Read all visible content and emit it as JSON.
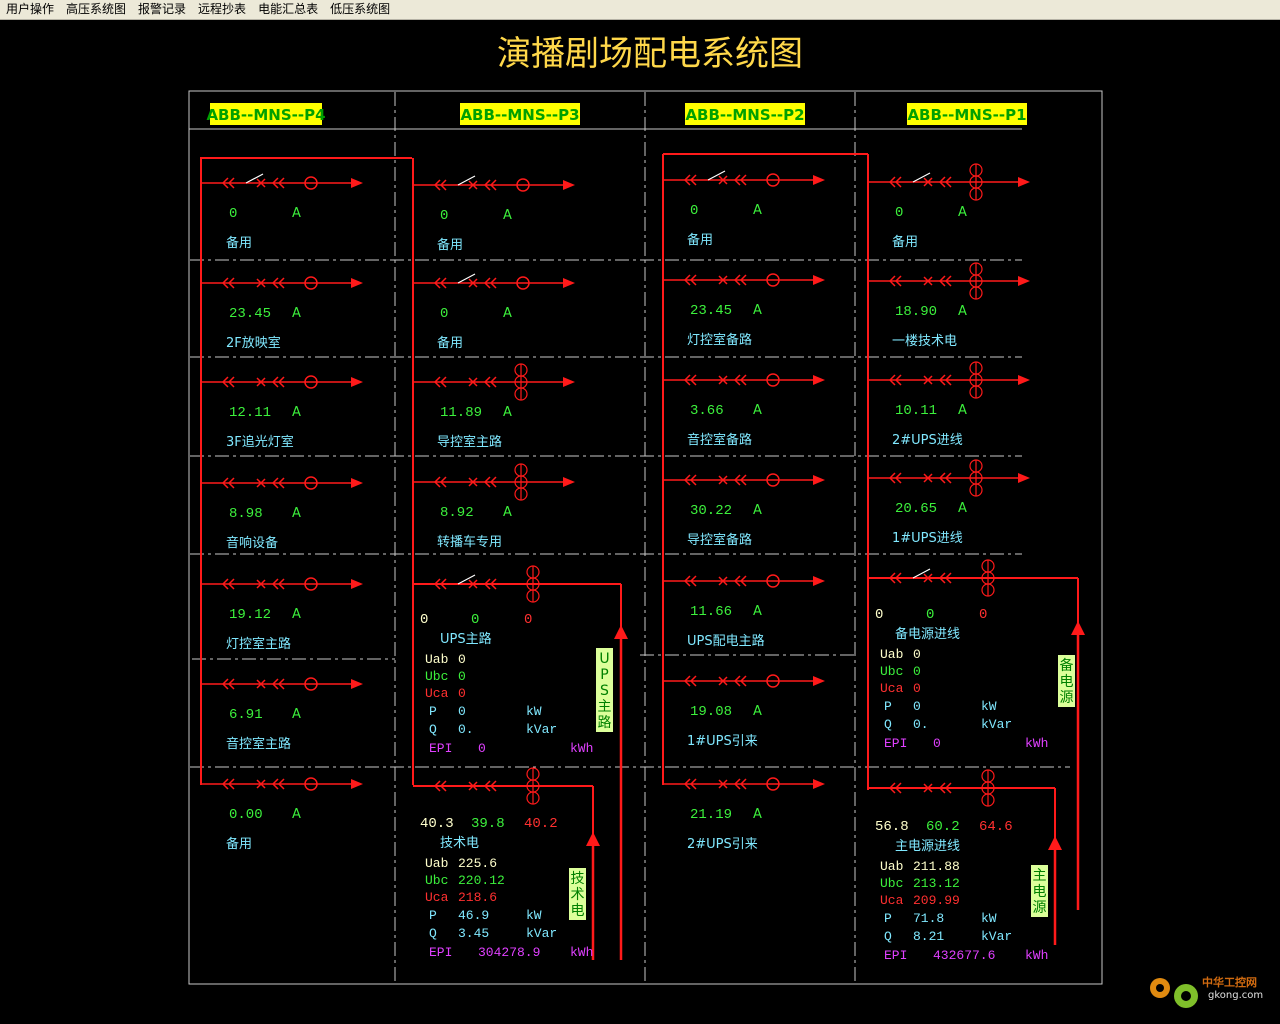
{
  "menu": [
    "用户操作",
    "高压系统图",
    "报警记录",
    "远程抄表",
    "电能汇总表",
    "低压系统图"
  ],
  "title": "演播剧场配电系统图",
  "panels": [
    "ABB--MNS--P4",
    "ABB--MNS--P3",
    "ABB--MNS--P2",
    "ABB--MNS--P1"
  ],
  "unit_a": "A",
  "p4": [
    {
      "value": "0",
      "name": "备用"
    },
    {
      "value": "23.45",
      "name": "2F放映室"
    },
    {
      "value": "12.11",
      "name": "3F追光灯室"
    },
    {
      "value": "8.98",
      "name": "音响设备"
    },
    {
      "value": "19.12",
      "name": "灯控室主路"
    },
    {
      "value": "6.91",
      "name": "音控室主路"
    },
    {
      "value": "0.00",
      "name": "备用"
    }
  ],
  "p3": [
    {
      "value": "0",
      "name": "备用"
    },
    {
      "value": "0",
      "name": "备用"
    },
    {
      "value": "11.89",
      "name": "导控室主路"
    },
    {
      "value": "8.92",
      "name": "转播车专用"
    }
  ],
  "p2": [
    {
      "value": "0",
      "name": "备用"
    },
    {
      "value": "23.45",
      "name": "灯控室备路"
    },
    {
      "value": "3.66",
      "name": "音控室备路"
    },
    {
      "value": "30.22",
      "name": "导控室备路"
    },
    {
      "value": "11.66",
      "name": "UPS配电主路"
    },
    {
      "value": "19.08",
      "name": "1#UPS引来"
    },
    {
      "value": "21.19",
      "name": "2#UPS引来"
    }
  ],
  "p1": [
    {
      "value": "0",
      "name": "备用"
    },
    {
      "value": "18.90",
      "name": "一楼技术电"
    },
    {
      "value": "10.11",
      "name": "2#UPS进线"
    },
    {
      "value": "20.65",
      "name": "1#UPS进线"
    }
  ],
  "labels": {
    "uab": "Uab",
    "ubc": "Ubc",
    "uca": "Uca",
    "p": "P",
    "q": "Q",
    "epi": "EPI",
    "kw": "kW",
    "kvar": "kVar",
    "kwh": "kWh"
  },
  "ups_main": {
    "name": "UPS主路",
    "i1": "0",
    "i2": "0",
    "i3": "0",
    "uab": "0",
    "ubc": "0",
    "uca": "0",
    "p": "0",
    "q": "0.",
    "epi": "0",
    "vertical": [
      "U",
      "P",
      "S",
      "主",
      "路"
    ]
  },
  "tech_power": {
    "name": "技术电",
    "i1": "40.3",
    "i2": "39.8",
    "i3": "40.2",
    "uab": "225.6",
    "ubc": "220.12",
    "uca": "218.6",
    "p": "46.9",
    "q": "3.45",
    "epi": "304278.9",
    "vertical": [
      "技",
      "术",
      "电"
    ]
  },
  "backup_in": {
    "name": "备电源进线",
    "i1": "0",
    "i2": "0",
    "i3": "0",
    "uab": "0",
    "ubc": "0",
    "uca": "0",
    "p": "0",
    "q": "0.",
    "epi": "0",
    "vertical": [
      "备",
      "电",
      "源"
    ]
  },
  "main_in": {
    "name": "主电源进线",
    "i1": "56.8",
    "i2": "60.2",
    "i3": "64.6",
    "uab": "211.88",
    "ubc": "213.12",
    "uca": "209.99",
    "p": "71.8",
    "q": "8.21",
    "epi": "432677.6",
    "vertical": [
      "主",
      "电",
      "源"
    ]
  },
  "logo": {
    "name": "中华工控网",
    "url_text": "gkong.com"
  },
  "colors": {
    "line": "#ff1a1a",
    "value": "#3cf03c",
    "label": "#80e8ff",
    "header_bg": "#ffff00",
    "header_text": "#00a000",
    "title": "#ffd84a",
    "epi": "#e040ff",
    "uca": "#ff3030",
    "uab": "#ffffcc",
    "vert_bg": "#dcff9a",
    "vert_text": "#008000"
  }
}
